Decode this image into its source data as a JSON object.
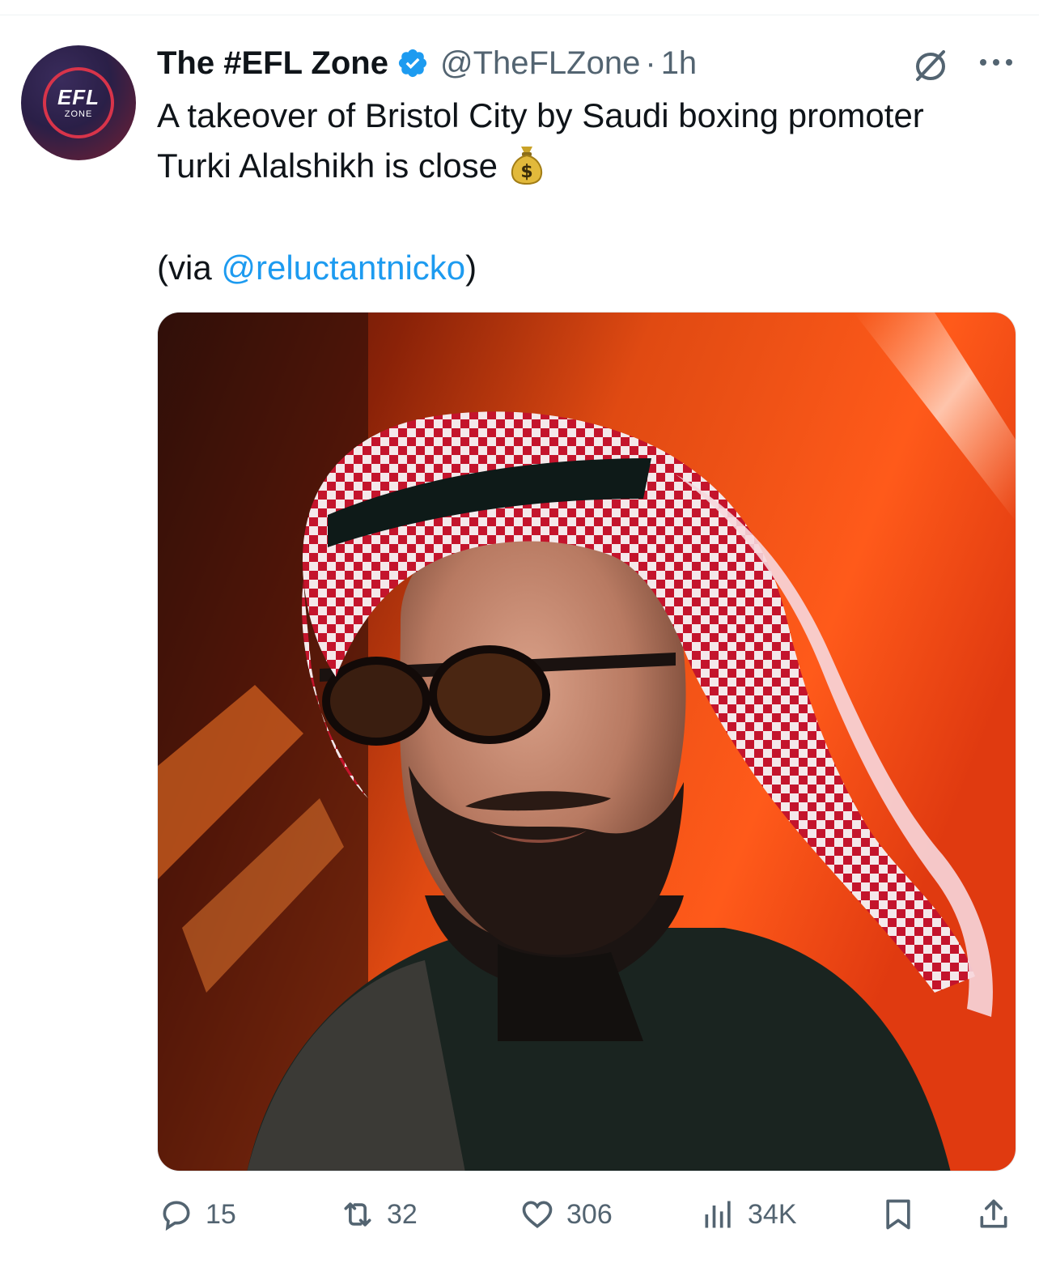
{
  "tweet": {
    "author": {
      "display_name": "The #EFL Zone",
      "handle": "@TheFLZone",
      "separator": "·",
      "time": "1h",
      "verified": true,
      "avatar": {
        "line1": "EFL",
        "line2": "ZONE"
      }
    },
    "text": "A takeover of Bristol City by Saudi boxing promoter Turki Alalshikh is close",
    "emoji": "money-bag",
    "via_prefix": "(via ",
    "via_mention": "@reluctantnicko",
    "via_suffix": ")",
    "media": {
      "kind": "photo"
    }
  },
  "actions": {
    "replies": "15",
    "reposts": "32",
    "likes": "306",
    "views": "34K"
  },
  "colors": {
    "text": "#0f1419",
    "secondary": "#536471",
    "link": "#1d9bf0",
    "verified": "#1d9bf0",
    "divider": "#eff3f4"
  },
  "icons": {
    "reply": "reply-icon",
    "repost": "repost-icon",
    "like": "heart-icon",
    "views": "views-icon",
    "bookmark": "bookmark-icon",
    "share": "share-icon",
    "grok": "grok-icon",
    "more": "more-icon"
  }
}
